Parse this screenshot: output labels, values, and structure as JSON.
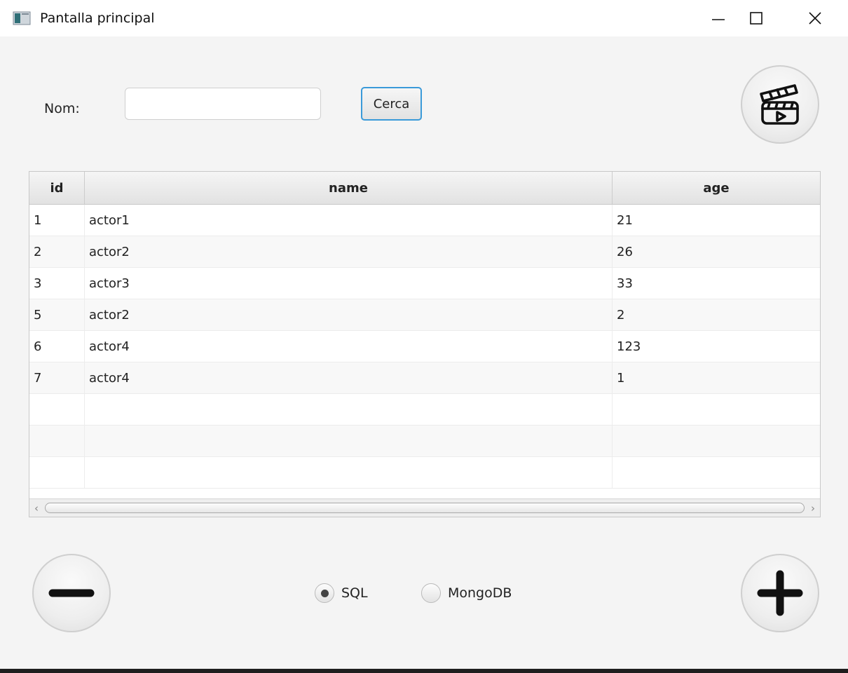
{
  "window": {
    "title": "Pantalla principal"
  },
  "search": {
    "label": "Nom:",
    "value": "",
    "placeholder": "",
    "button_label": "Cerca"
  },
  "table": {
    "columns": [
      "id",
      "name",
      "age"
    ],
    "rows": [
      [
        "1",
        "actor1",
        "21"
      ],
      [
        "2",
        "actor2",
        "26"
      ],
      [
        "3",
        "actor3",
        "33"
      ],
      [
        "5",
        "actor2",
        "2"
      ],
      [
        "6",
        "actor4",
        "123"
      ],
      [
        "7",
        "actor4",
        "1"
      ]
    ],
    "empty_rows": 3
  },
  "database": {
    "options": [
      {
        "label": "SQL",
        "selected": true
      },
      {
        "label": "MongoDB",
        "selected": false
      }
    ]
  },
  "icons": {
    "film": "film-clapperboard-icon",
    "remove": "minus-icon",
    "add": "plus-icon"
  }
}
